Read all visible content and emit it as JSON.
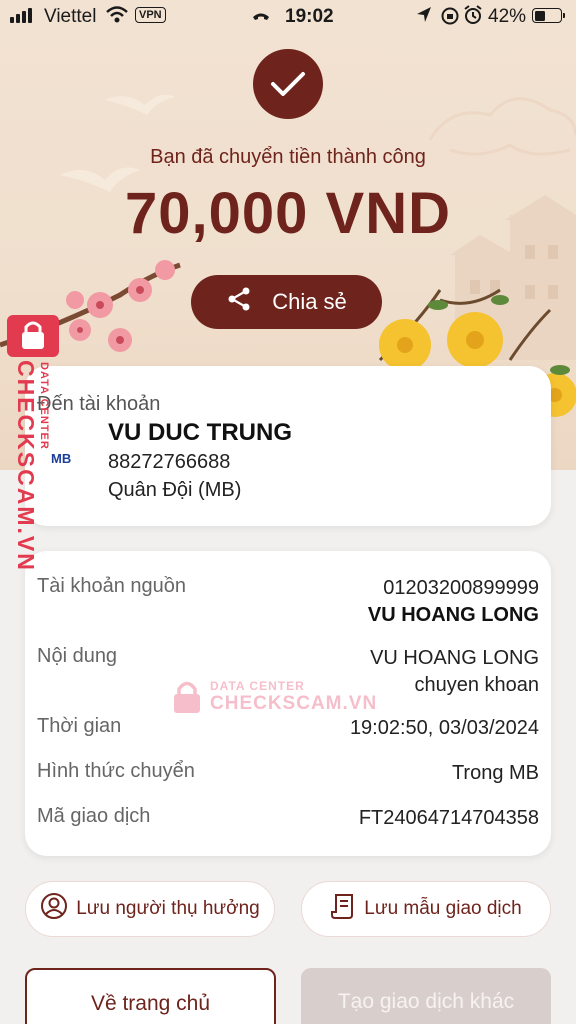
{
  "status_bar": {
    "carrier": "Viettel",
    "vpn": "VPN",
    "time": "19:02",
    "battery": "42%",
    "battery_level": 0.42
  },
  "hero": {
    "success_message": "Bạn đã chuyển tiền thành công",
    "amount": "70,000 VND",
    "share_label": "Chia sẻ"
  },
  "recipient": {
    "label": "Đến tài khoản",
    "bank_logo": "MB",
    "name": "VU DUC TRUNG",
    "account": "88272766688",
    "bank": "Quân Đội (MB)"
  },
  "details": [
    {
      "label": "Tài khoản nguồn",
      "value": "01203200899999",
      "value_bold": "VU HOANG LONG"
    },
    {
      "label": "Nội dung",
      "value": "VU HOANG LONG",
      "value2": "chuyen khoan"
    },
    {
      "label": "Thời gian",
      "value": "19:02:50, 03/03/2024"
    },
    {
      "label": "Hình thức chuyển",
      "value": "Trong MB"
    },
    {
      "label": "Mã giao dịch",
      "value": "FT24064714704358"
    }
  ],
  "actions": {
    "save_beneficiary": "Lưu người thụ hưởng",
    "save_template": "Lưu mẫu giao dịch",
    "home": "Về trang chủ",
    "new_transaction": "Tạo giao dịch khác"
  },
  "watermark": {
    "brand": "CHECKSCAM.VN",
    "side_small": "DATA CENTER",
    "center_small": "DATA CENTER",
    "center_big": "CHECKSCAM.VN"
  },
  "colors": {
    "primary": "#6e231c",
    "hero_bg": "#f0dfcd",
    "watermark": "#e23a4f",
    "disabled_button": "#d8cfcc"
  }
}
